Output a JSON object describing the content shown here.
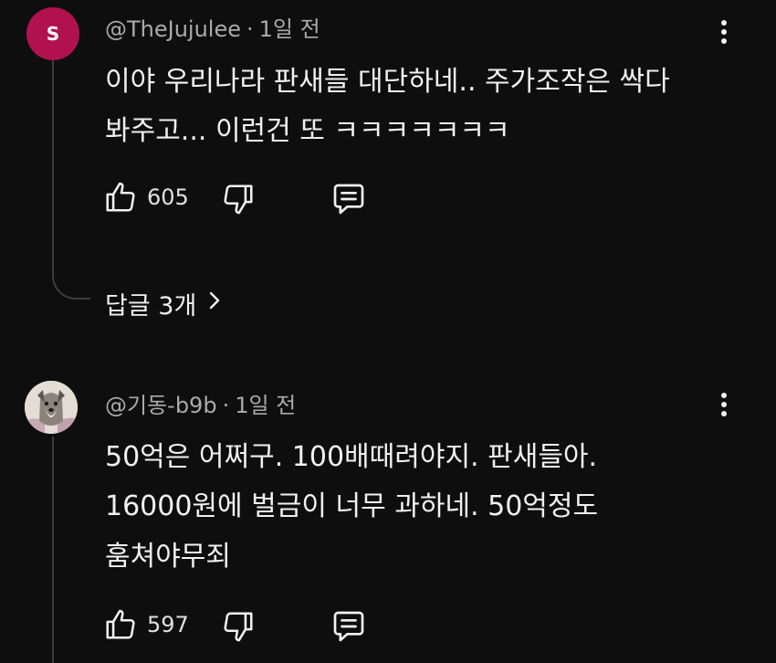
{
  "comments": [
    {
      "avatar_letter": "S",
      "avatar_color": "#b1124f",
      "author": "@TheJujulee",
      "time": "1일 전",
      "lines": [
        "이야 우리나라 판새들 대단하네.. 주가조작은 싹다",
        "봐주고... 이런건 또 ㅋㅋㅋㅋㅋㅋㅋ"
      ],
      "likes": "605",
      "replies_label": "답글 3개"
    },
    {
      "avatar_letter": "",
      "author": "@기동-b9b",
      "time": "1일 전",
      "lines": [
        "50억은 어쩌구. 100배때려야지. 판새들아.",
        "16000원에 벌금이 너무 과하네.  50억정도",
        "훔쳐야무죄"
      ],
      "likes": "597"
    }
  ],
  "icons": {
    "like": "thumbs-up-icon",
    "dislike": "thumbs-down-icon",
    "reply": "comment-reply-icon",
    "more": "more-vertical-icon",
    "chevron": "chevron-right-icon"
  },
  "colors": {
    "background": "#0e0e0e",
    "text": "#f1f1f1",
    "meta": "#aaaaaa",
    "thread_line": "#3d3d3d"
  }
}
